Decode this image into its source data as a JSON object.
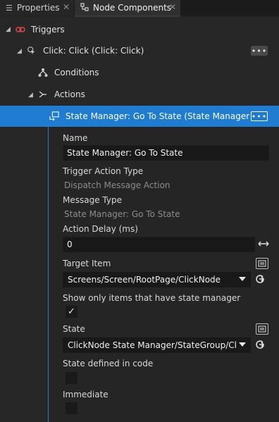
{
  "tabs": [
    {
      "label": "Properties",
      "icon": "list-icon"
    },
    {
      "label": "Node Components",
      "icon": "node-components-icon"
    }
  ],
  "tree": {
    "triggers_label": "Triggers",
    "click_label": "Click: Click (Click: Click)",
    "conditions_label": "Conditions",
    "actions_label": "Actions",
    "selected_action_label": "State Manager: Go To State (State Manager: Go To State)"
  },
  "properties": {
    "name_label": "Name",
    "name_value": "State Manager: Go To State",
    "trigger_action_type_label": "Trigger Action Type",
    "trigger_action_type_value": "Dispatch Message Action",
    "message_type_label": "Message Type",
    "message_type_value": "State Manager: Go To State",
    "action_delay_label": "Action Delay (ms)",
    "action_delay_value": "0",
    "target_item_label": "Target Item",
    "target_item_value": "Screens/Screen/RootPage/ClickNode",
    "show_only_label": "Show only items that have state manager",
    "show_only_checked": true,
    "state_label": "State",
    "state_value": "ClickNode State Manager/StateGroup/Click",
    "state_defined_label": "State defined in code",
    "state_defined_checked": false,
    "immediate_label": "Immediate",
    "immediate_checked": false
  },
  "colors": {
    "selection": "#1f7cd0",
    "trigger_icon": "#e0484a",
    "panel_border": "#2f7ab8"
  }
}
